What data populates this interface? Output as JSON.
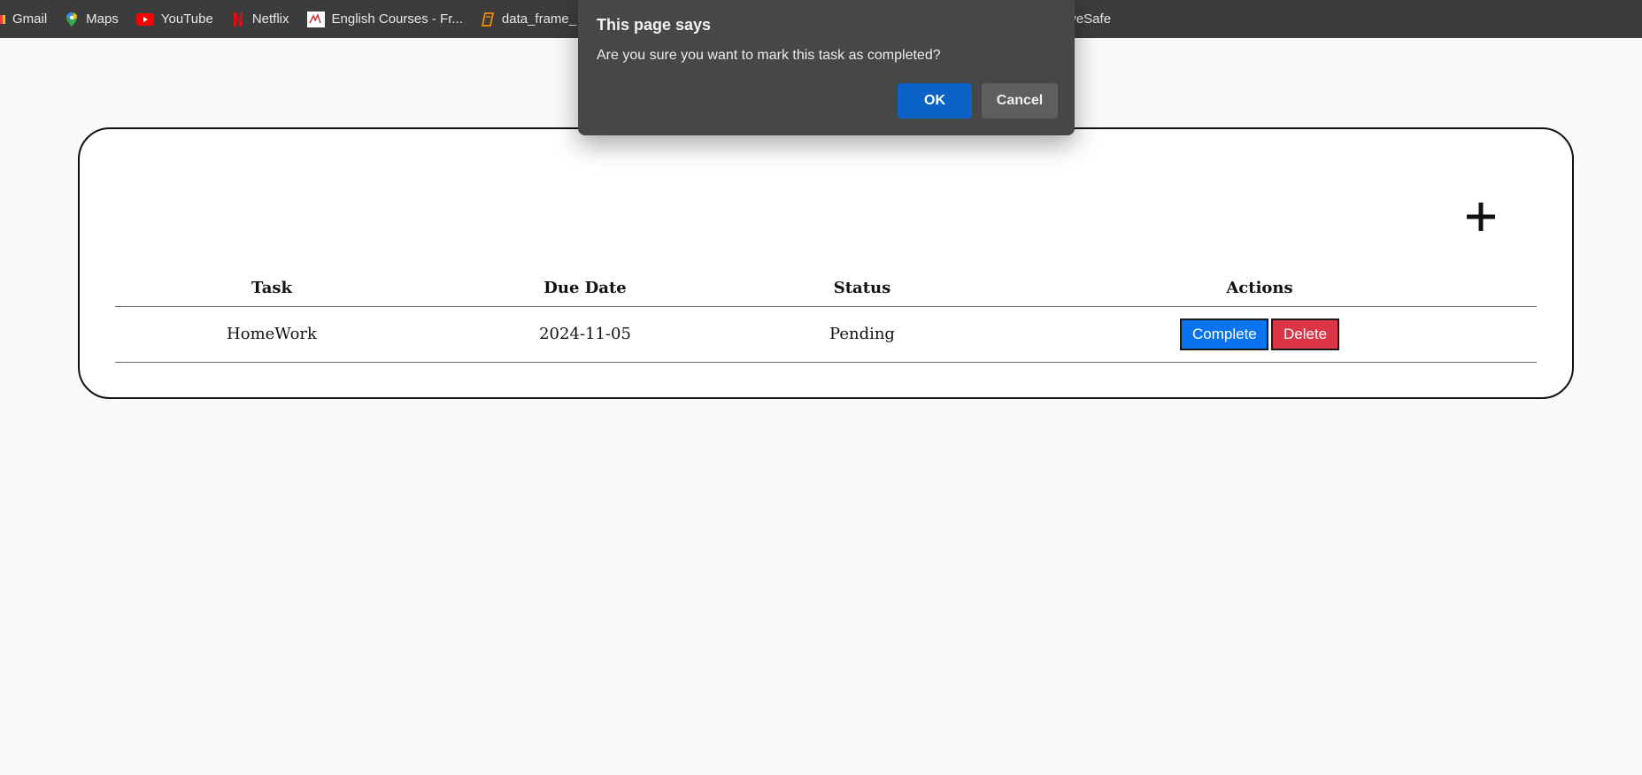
{
  "bookmarks": [
    {
      "label": "Gmail",
      "icon": "gmail-icon"
    },
    {
      "label": "Maps",
      "icon": "maps-icon"
    },
    {
      "label": "YouTube",
      "icon": "youtube-icon"
    },
    {
      "label": "Netflix",
      "icon": "netflix-icon"
    },
    {
      "label": "English Courses - Fr...",
      "icon": "english-courses-icon"
    },
    {
      "label": "data_frame_",
      "icon": "book-icon"
    }
  ],
  "bookmark_partial": "iveSafe",
  "dialog": {
    "title": "This page says",
    "message": "Are you sure you want to mark this task as completed?",
    "ok_label": "OK",
    "cancel_label": "Cancel"
  },
  "table": {
    "headers": [
      "Task",
      "Due Date",
      "Status",
      "Actions"
    ],
    "rows": [
      {
        "task": "HomeWork",
        "due_date": "2024-11-05",
        "status": "Pending",
        "complete_label": "Complete",
        "delete_label": "Delete"
      }
    ]
  },
  "add_button": {
    "icon": "plus-icon"
  },
  "colors": {
    "bookmarks_bg": "#3c3c3c",
    "dialog_bg": "#474747",
    "ok_button": "#0b63c5",
    "complete_button": "#0a74f0",
    "delete_button": "#dc3545"
  }
}
